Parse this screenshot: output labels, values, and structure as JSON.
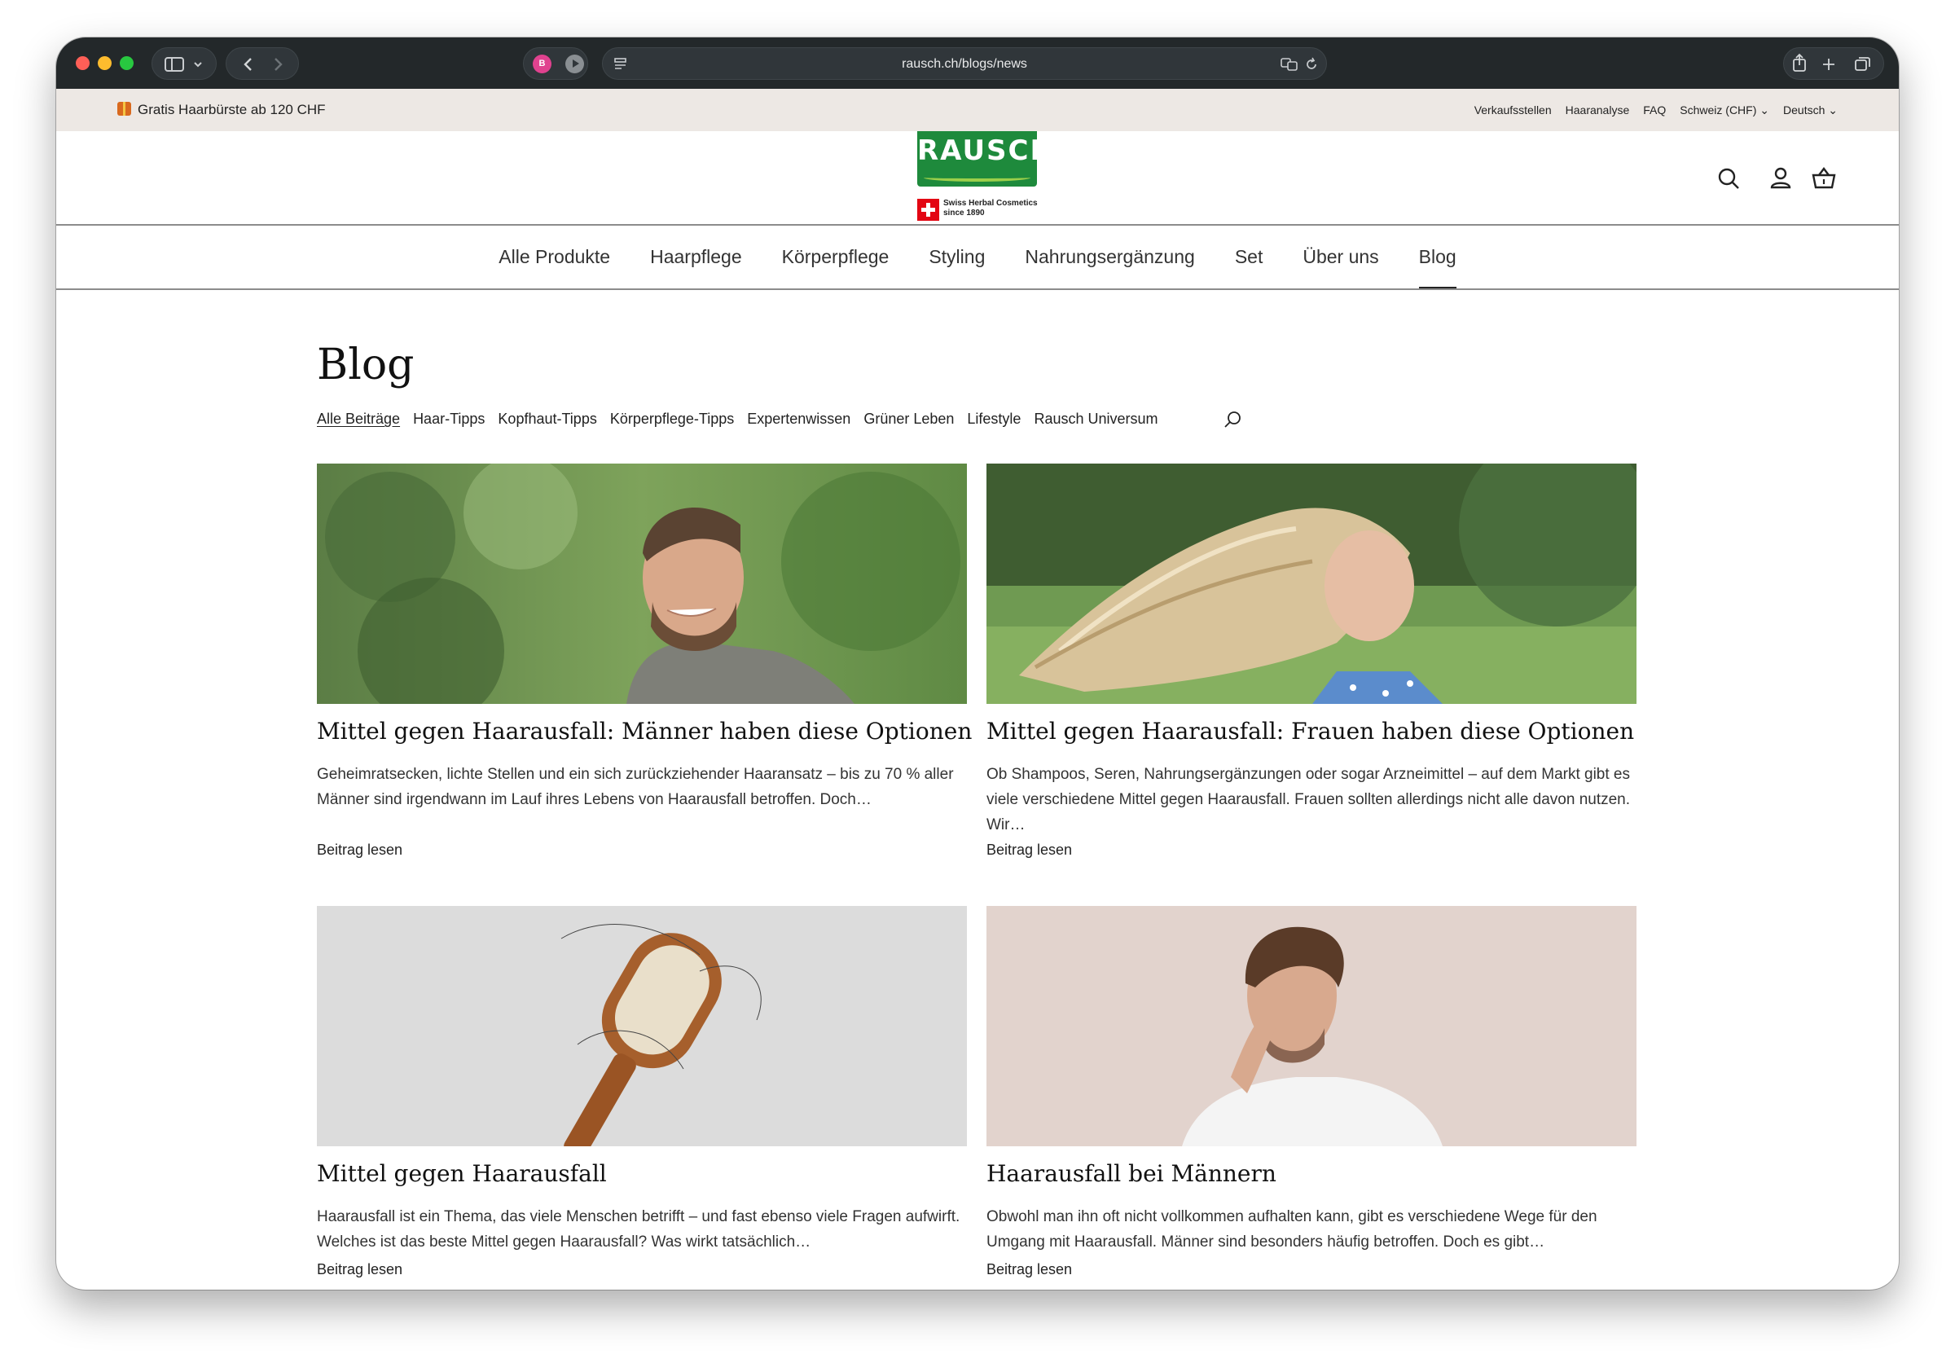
{
  "browser": {
    "url": "rausch.ch/blogs/news",
    "extension_badge": "B"
  },
  "announcement": {
    "left": "Gratis Haarbürste ab 120 CHF",
    "links": [
      "Verkaufsstellen",
      "Haaranalyse",
      "FAQ",
      "Schweiz (CHF) ⌄",
      "Deutsch ⌄"
    ]
  },
  "header": {
    "logo": "RAUSCH",
    "tagline_line1": "Swiss Herbal Cosmetics",
    "tagline_line2": "since 1890",
    "icons": [
      "search-icon",
      "account-icon",
      "cart-icon"
    ]
  },
  "nav": {
    "items": [
      "Alle Produkte",
      "Haarpflege",
      "Körperpflege",
      "Styling",
      "Nahrungsergänzung",
      "Set",
      "Über uns",
      "Blog"
    ],
    "active": "Blog"
  },
  "blog": {
    "title": "Blog",
    "categories": [
      "Alle Beiträge",
      "Haar-Tipps",
      "Kopfhaut-Tipps",
      "Körperpflege-Tipps",
      "Expertenwissen",
      "Grüner Leben",
      "Lifestyle",
      "Rausch Universum"
    ],
    "active_category": "Alle Beiträge",
    "read_more": "Beitrag lesen",
    "posts": [
      {
        "title": "Mittel gegen Haarausfall: Männer haben diese Optionen",
        "excerpt": "Geheimratsecken, lichte Stellen und ein sich zurückziehender Haaransatz – bis zu 70 % aller Männer sind irgendwann im Lauf ihres Lebens von Haarausfall betroffen. Doch…",
        "image": "smiling-bearded-man-outdoors"
      },
      {
        "title": "Mittel gegen Haarausfall: Frauen haben diese Optionen",
        "excerpt": "Ob Shampoos, Seren, Nahrungsergänzungen oder sogar Arzneimittel – auf dem Markt gibt es viele verschiedene Mittel gegen Haarausfall. Frauen sollten allerdings nicht alle davon nutzen. Wir…",
        "image": "blonde-woman-hair-in-wind"
      },
      {
        "title": "Mittel gegen Haarausfall",
        "excerpt": "Haarausfall ist ein Thema, das viele Menschen betrifft – und fast ebenso viele Fragen aufwirft. Welches ist das beste Mittel gegen Haarausfall? Was wirkt tatsächlich…",
        "image": "wooden-hairbrush-with-hair"
      },
      {
        "title": "Haarausfall bei Männern",
        "excerpt": "Obwohl man ihn oft nicht vollkommen aufhalten kann, gibt es verschiedene Wege für den Umgang mit Haarausfall. Männer sind besonders häufig betroffen. Doch es gibt…",
        "image": "man-in-white-shirt-portrait"
      }
    ]
  },
  "colors": {
    "brand_green": "#1e8a3c",
    "announcement_bg": "#ede8e4",
    "toolbar_bg": "#23282a"
  }
}
